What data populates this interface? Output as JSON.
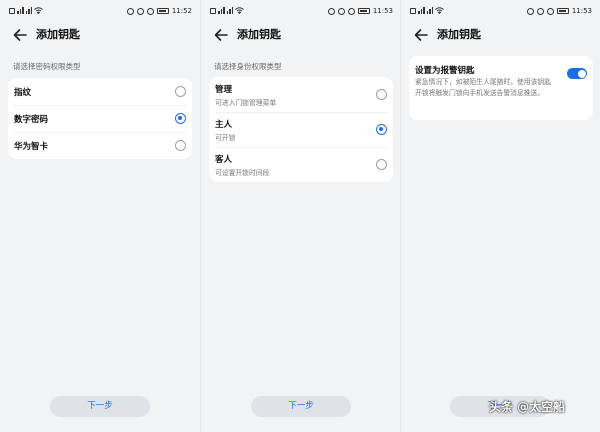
{
  "screens": [
    {
      "status_time": "11:52",
      "title": "添加钥匙",
      "section_label": "请选择密码权限类型",
      "options": [
        {
          "label": "指纹",
          "selected": false
        },
        {
          "label": "数字密码",
          "selected": true
        },
        {
          "label": "华为智卡",
          "selected": false
        }
      ],
      "next_label": "下一步"
    },
    {
      "status_time": "11:53",
      "title": "添加钥匙",
      "section_label": "请选择身份权限类型",
      "options": [
        {
          "label": "管理",
          "sub": "可进入门锁管理菜单",
          "selected": false
        },
        {
          "label": "主人",
          "sub": "可开锁",
          "selected": true
        },
        {
          "label": "客人",
          "sub": "可设置开锁时间段",
          "selected": false
        }
      ],
      "next_label": "下一步"
    },
    {
      "status_time": "11:53",
      "title": "添加钥匙",
      "alarm": {
        "title": "设置为报警钥匙",
        "description": "紧急情况下，如被陌生人尾随时，使用该钥匙开锁将触发门锁向手机发送告警消息推送。",
        "enabled": true
      },
      "next_label": "下一步"
    }
  ],
  "watermark": "头条 @太空船",
  "colors": {
    "accent": "#1a6ee8",
    "background": "#f1f3f5",
    "card": "#ffffff"
  },
  "icons": [
    "back-arrow-icon",
    "sim-icon",
    "signal-icon",
    "wifi-icon",
    "nfc-icon",
    "eye-icon",
    "alarm-icon",
    "battery-icon"
  ]
}
